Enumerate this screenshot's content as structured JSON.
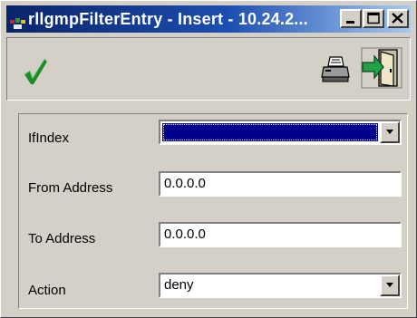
{
  "window": {
    "title": "rllgmpFilterEntry - Insert - 10.24.2..."
  },
  "toolbar": {
    "ok_icon": "checkmark-icon",
    "print_icon": "printer-icon",
    "exit_icon": "exit-door-icon"
  },
  "form": {
    "ifindex_label": "IfIndex",
    "ifindex_value": "",
    "from_address_label": "From Address",
    "from_address_value": "0.0.0.0",
    "to_address_label": "To Address",
    "to_address_value": "0.0.0.0",
    "action_label": "Action",
    "action_value": "deny"
  },
  "colors": {
    "titlebar_start": "#0a246a",
    "titlebar_end": "#a6caf0",
    "selection": "#00008b",
    "checkmark": "#1e8c2a",
    "window_face": "#d4d0c8"
  }
}
